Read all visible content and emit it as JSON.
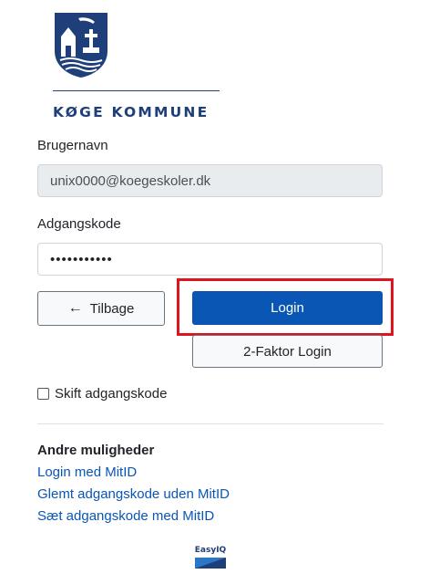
{
  "brand": {
    "name": "KØGE KOMMUNE",
    "logo_icon": "koege-coat-of-arms-icon",
    "color": "#1f3f7a"
  },
  "username": {
    "label": "Brugernavn",
    "value": "unix0000@koegeskoler.dk"
  },
  "password": {
    "label": "Adgangskode",
    "value": "•••••••••••"
  },
  "buttons": {
    "back": "Tilbage",
    "back_icon": "arrow-left-icon",
    "login": "Login",
    "two_factor": "2-Faktor Login"
  },
  "change_password": {
    "label": "Skift adgangskode",
    "checked": false
  },
  "other_options": {
    "title": "Andre muligheder",
    "links": [
      "Login med MitID",
      "Glemt adgangskode uden MitID",
      "Sæt adgangskode med MitID"
    ]
  },
  "footer": {
    "logo_text": "EasyIQ"
  },
  "colors": {
    "primary": "#0a56b5",
    "highlight": "#e0141e"
  }
}
